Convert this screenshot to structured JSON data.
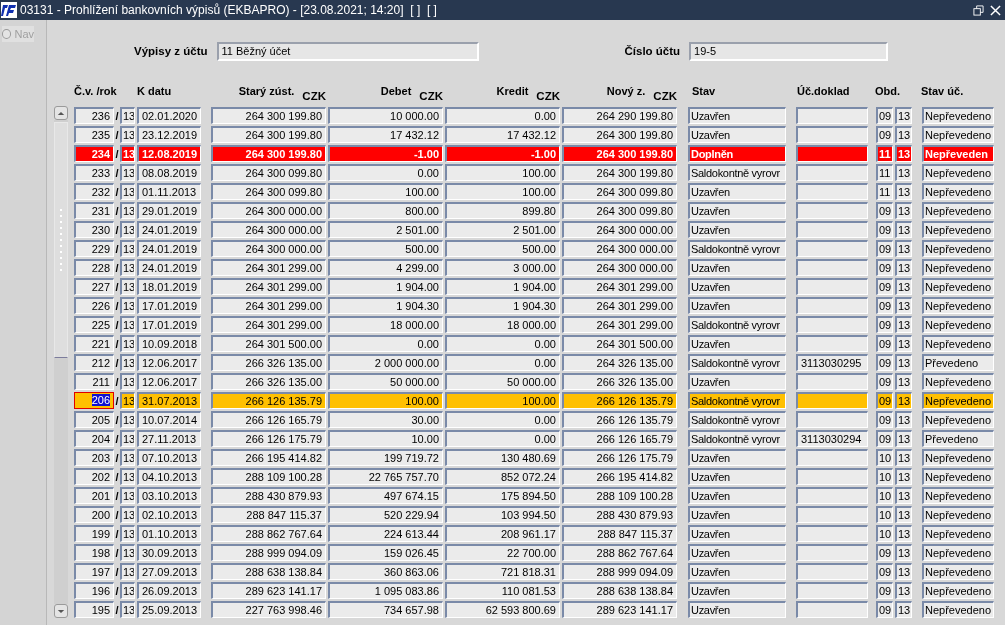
{
  "window": {
    "title": "03131 - Prohlížení bankovních výpisů (EKBAPRO) - [23.08.2021; 14:20]  [ ]  [ ]"
  },
  "nav": {
    "label": "Nav",
    "selected": false
  },
  "filters": [
    {
      "label": "Výpisy z účtu",
      "value": "11 Běžný účet"
    },
    {
      "label": "Číslo účtu",
      "value": "19-5"
    }
  ],
  "columns": [
    {
      "label": "Č.v. /rok"
    },
    {
      "label": "K datu"
    },
    {
      "label": "Starý zúst.",
      "currency": "CZK"
    },
    {
      "label": "Debet",
      "currency": "CZK"
    },
    {
      "label": "Kredit",
      "currency": "CZK"
    },
    {
      "label": "Nový z.",
      "currency": "CZK"
    },
    {
      "label": "Stav"
    },
    {
      "label": "Úč.doklad"
    },
    {
      "label": "Obd."
    },
    {
      "label": "Stav úč."
    }
  ],
  "rows": [
    {
      "number": "236",
      "separator": "/",
      "year": "13",
      "date": "02.01.2020",
      "old_balance": "264 300 199.80",
      "debit": "10 000.00",
      "credit": "0.00",
      "new_balance": "264 290 199.80",
      "state": "Uzavřen",
      "period": "09",
      "period_year": "13",
      "posting_state": "Nepřevedeno",
      "selected": false,
      "flagged": false
    },
    {
      "number": "235",
      "separator": "/",
      "year": "13",
      "date": "23.12.2019",
      "old_balance": "264 300 199.80",
      "debit": "17 432.12",
      "credit": "17 432.12",
      "new_balance": "264 300 199.80",
      "state": "Uzavřen",
      "period": "09",
      "period_year": "13",
      "posting_state": "Nepřevedeno",
      "selected": false,
      "flagged": false
    },
    {
      "number": "234",
      "separator": "/",
      "year": "13",
      "date": "12.08.2019",
      "old_balance": "264 300 199.80",
      "debit": "-1.00",
      "credit": "-1.00",
      "new_balance": "264 300 199.80",
      "state": "Doplněn",
      "period": "11",
      "period_year": "13",
      "posting_state": "Nepřeveden",
      "selected": false,
      "flagged": true
    },
    {
      "number": "233",
      "separator": "/",
      "year": "13",
      "date": "08.08.2019",
      "old_balance": "264 300 099.80",
      "debit": "0.00",
      "credit": "100.00",
      "new_balance": "264 300 199.80",
      "state": "Saldokontně vyrovr",
      "period": "11",
      "period_year": "13",
      "posting_state": "Nepřevedeno",
      "selected": false,
      "flagged": false
    },
    {
      "number": "232",
      "separator": "/",
      "year": "13",
      "date": "01.11.2013",
      "old_balance": "264 300 099.80",
      "debit": "100.00",
      "credit": "100.00",
      "new_balance": "264 300 099.80",
      "state": "Uzavřen",
      "period": "11",
      "period_year": "13",
      "posting_state": "Nepřevedeno",
      "selected": false,
      "flagged": false
    },
    {
      "number": "231",
      "separator": "/",
      "year": "13",
      "date": "29.01.2019",
      "old_balance": "264 300 000.00",
      "debit": "800.00",
      "credit": "899.80",
      "new_balance": "264 300 099.80",
      "state": "Uzavřen",
      "period": "09",
      "period_year": "13",
      "posting_state": "Nepřevedeno",
      "selected": false,
      "flagged": false
    },
    {
      "number": "230",
      "separator": "/",
      "year": "13",
      "date": "24.01.2019",
      "old_balance": "264 300 000.00",
      "debit": "2 501.00",
      "credit": "2 501.00",
      "new_balance": "264 300 000.00",
      "state": "Uzavřen",
      "period": "09",
      "period_year": "13",
      "posting_state": "Nepřevedeno",
      "selected": false,
      "flagged": false
    },
    {
      "number": "229",
      "separator": "/",
      "year": "13",
      "date": "24.01.2019",
      "old_balance": "264 300 000.00",
      "debit": "500.00",
      "credit": "500.00",
      "new_balance": "264 300 000.00",
      "state": "Saldokontně vyrovr",
      "period": "09",
      "period_year": "13",
      "posting_state": "Nepřevedeno",
      "selected": false,
      "flagged": false
    },
    {
      "number": "228",
      "separator": "/",
      "year": "13",
      "date": "24.01.2019",
      "old_balance": "264 301 299.00",
      "debit": "4 299.00",
      "credit": "3 000.00",
      "new_balance": "264 300 000.00",
      "state": "Uzavřen",
      "period": "09",
      "period_year": "13",
      "posting_state": "Nepřevedeno",
      "selected": false,
      "flagged": false
    },
    {
      "number": "227",
      "separator": "/",
      "year": "13",
      "date": "18.01.2019",
      "old_balance": "264 301 299.00",
      "debit": "1 904.00",
      "credit": "1 904.00",
      "new_balance": "264 301 299.00",
      "state": "Uzavřen",
      "period": "09",
      "period_year": "13",
      "posting_state": "Nepřevedeno",
      "selected": false,
      "flagged": false
    },
    {
      "number": "226",
      "separator": "/",
      "year": "13",
      "date": "17.01.2019",
      "old_balance": "264 301 299.00",
      "debit": "1 904.30",
      "credit": "1 904.30",
      "new_balance": "264 301 299.00",
      "state": "Uzavřen",
      "period": "09",
      "period_year": "13",
      "posting_state": "Nepřevedeno",
      "selected": false,
      "flagged": false
    },
    {
      "number": "225",
      "separator": "/",
      "year": "13",
      "date": "17.01.2019",
      "old_balance": "264 301 299.00",
      "debit": "18 000.00",
      "credit": "18 000.00",
      "new_balance": "264 301 299.00",
      "state": "Saldokontně vyrovr",
      "period": "09",
      "period_year": "13",
      "posting_state": "Nepřevedeno",
      "selected": false,
      "flagged": false
    },
    {
      "number": "221",
      "separator": "/",
      "year": "13",
      "date": "10.09.2018",
      "old_balance": "264 301 500.00",
      "debit": "0.00",
      "credit": "0.00",
      "new_balance": "264 301 500.00",
      "state": "Uzavřen",
      "period": "09",
      "period_year": "13",
      "posting_state": "Nepřevedeno",
      "selected": false,
      "flagged": false
    },
    {
      "number": "212",
      "separator": "/",
      "year": "13",
      "date": "12.06.2017",
      "old_balance": "266 326 135.00",
      "debit": "2 000 000.00",
      "credit": "0.00",
      "new_balance": "264 326 135.00",
      "state": "Saldokontně vyrovr",
      "document": "3113030295",
      "period": "09",
      "period_year": "13",
      "posting_state": "Převedeno",
      "selected": false,
      "flagged": false
    },
    {
      "number": "211",
      "separator": "/",
      "year": "13",
      "date": "12.06.2017",
      "old_balance": "266 326 135.00",
      "debit": "50 000.00",
      "credit": "50 000.00",
      "new_balance": "266 326 135.00",
      "state": "Uzavřen",
      "period": "09",
      "period_year": "13",
      "posting_state": "Nepřevedeno",
      "selected": false,
      "flagged": false
    },
    {
      "number": "206",
      "separator": "/",
      "year": "13",
      "date": "31.07.2013",
      "old_balance": "266 126 135.79",
      "debit": "100.00",
      "credit": "100.00",
      "new_balance": "266 126 135.79",
      "state": "Saldokontně vyrovr",
      "period": "09",
      "period_year": "13",
      "posting_state": "Nepřevedeno",
      "selected": true,
      "flagged": false
    },
    {
      "number": "205",
      "separator": "/",
      "year": "13",
      "date": "10.07.2014",
      "old_balance": "266 126 165.79",
      "debit": "30.00",
      "credit": "0.00",
      "new_balance": "266 126 135.79",
      "state": "Saldokontně vyrovr",
      "period": "09",
      "period_year": "13",
      "posting_state": "Nepřevedeno",
      "selected": false,
      "flagged": false
    },
    {
      "number": "204",
      "separator": "/",
      "year": "13",
      "date": "27.11.2013",
      "old_balance": "266 126 175.79",
      "debit": "10.00",
      "credit": "0.00",
      "new_balance": "266 126 165.79",
      "state": "Saldokontně vyrovr",
      "document": "3113030294",
      "period": "09",
      "period_year": "13",
      "posting_state": "Převedeno",
      "selected": false,
      "flagged": false
    },
    {
      "number": "203",
      "separator": "/",
      "year": "13",
      "date": "07.10.2013",
      "old_balance": "266 195 414.82",
      "debit": "199 719.72",
      "credit": "130 480.69",
      "new_balance": "266 126 175.79",
      "state": "Uzavřen",
      "period": "10",
      "period_year": "13",
      "posting_state": "Nepřevedeno",
      "selected": false,
      "flagged": false
    },
    {
      "number": "202",
      "separator": "/",
      "year": "13",
      "date": "04.10.2013",
      "old_balance": "288 109 100.28",
      "debit": "22 765 757.70",
      "credit": "852 072.24",
      "new_balance": "266 195 414.82",
      "state": "Uzavřen",
      "period": "10",
      "period_year": "13",
      "posting_state": "Nepřevedeno",
      "selected": false,
      "flagged": false
    },
    {
      "number": "201",
      "separator": "/",
      "year": "13",
      "date": "03.10.2013",
      "old_balance": "288 430 879.93",
      "debit": "497 674.15",
      "credit": "175 894.50",
      "new_balance": "288 109 100.28",
      "state": "Uzavřen",
      "period": "10",
      "period_year": "13",
      "posting_state": "Nepřevedeno",
      "selected": false,
      "flagged": false
    },
    {
      "number": "200",
      "separator": "/",
      "year": "13",
      "date": "02.10.2013",
      "old_balance": "288 847 115.37",
      "debit": "520 229.94",
      "credit": "103 994.50",
      "new_balance": "288 430 879.93",
      "state": "Uzavřen",
      "period": "10",
      "period_year": "13",
      "posting_state": "Nepřevedeno",
      "selected": false,
      "flagged": false
    },
    {
      "number": "199",
      "separator": "/",
      "year": "13",
      "date": "01.10.2013",
      "old_balance": "288 862 767.64",
      "debit": "224 613.44",
      "credit": "208 961.17",
      "new_balance": "288 847 115.37",
      "state": "Uzavřen",
      "period": "10",
      "period_year": "13",
      "posting_state": "Nepřevedeno",
      "selected": false,
      "flagged": false
    },
    {
      "number": "198",
      "separator": "/",
      "year": "13",
      "date": "30.09.2013",
      "old_balance": "288 999 094.09",
      "debit": "159 026.45",
      "credit": "22 700.00",
      "new_balance": "288 862 767.64",
      "state": "Uzavřen",
      "period": "09",
      "period_year": "13",
      "posting_state": "Nepřevedeno",
      "selected": false,
      "flagged": false
    },
    {
      "number": "197",
      "separator": "/",
      "year": "13",
      "date": "27.09.2013",
      "old_balance": "288 638 138.84",
      "debit": "360 863.06",
      "credit": "721 818.31",
      "new_balance": "288 999 094.09",
      "state": "Uzavřen",
      "period": "09",
      "period_year": "13",
      "posting_state": "Nepřevedeno",
      "selected": false,
      "flagged": false
    },
    {
      "number": "196",
      "separator": "/",
      "year": "13",
      "date": "26.09.2013",
      "old_balance": "289 623 141.17",
      "debit": "1 095 083.86",
      "credit": "110 081.53",
      "new_balance": "288 638 138.84",
      "state": "Uzavřen",
      "period": "09",
      "period_year": "13",
      "posting_state": "Nepřevedeno",
      "selected": false,
      "flagged": false
    },
    {
      "number": "195",
      "separator": "/",
      "year": "13",
      "date": "25.09.2013",
      "old_balance": "227 763 998.46",
      "debit": "734 657.98",
      "credit": "62 593 800.69",
      "new_balance": "289 623 141.17",
      "state": "Uzavřen",
      "period": "09",
      "period_year": "13",
      "posting_state": "Nepřevedeno",
      "selected": false,
      "flagged": false
    }
  ]
}
